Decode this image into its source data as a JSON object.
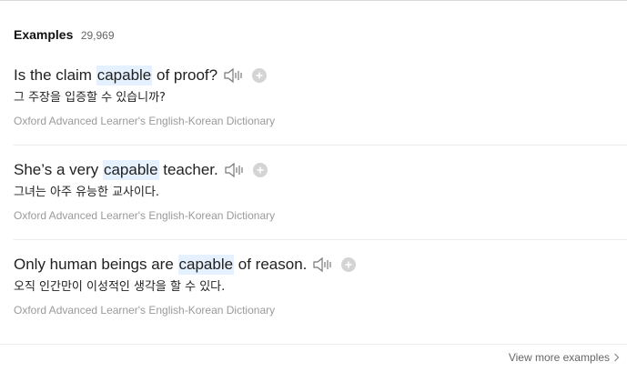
{
  "header": {
    "title": "Examples",
    "count": "29,969"
  },
  "examples": [
    {
      "before": "Is the claim ",
      "highlight": "capable",
      "after": " of proof?",
      "translation": "그 주장을 입증할 수 있습니까?",
      "source": "Oxford Advanced Learner's English-Korean Dictionary"
    },
    {
      "before": "She’s a very ",
      "highlight": "capable",
      "after": " teacher.",
      "translation": "그녀는 아주 유능한 교사이다.",
      "source": "Oxford Advanced Learner's English-Korean Dictionary"
    },
    {
      "before": "Only human beings are ",
      "highlight": "capable",
      "after": " of reason.",
      "translation": "오직 인간만이 이성적인 생각을 할 수 있다.",
      "source": "Oxford Advanced Learner's English-Korean Dictionary"
    }
  ],
  "footer": {
    "view_more_label": "View more examples"
  },
  "icons": {
    "speaker": "speaker-icon",
    "add": "plus-circle-icon",
    "more": "chevron-right-icon"
  },
  "colors": {
    "highlight": "#e5f1ff",
    "source_text": "#9a9a9a"
  }
}
